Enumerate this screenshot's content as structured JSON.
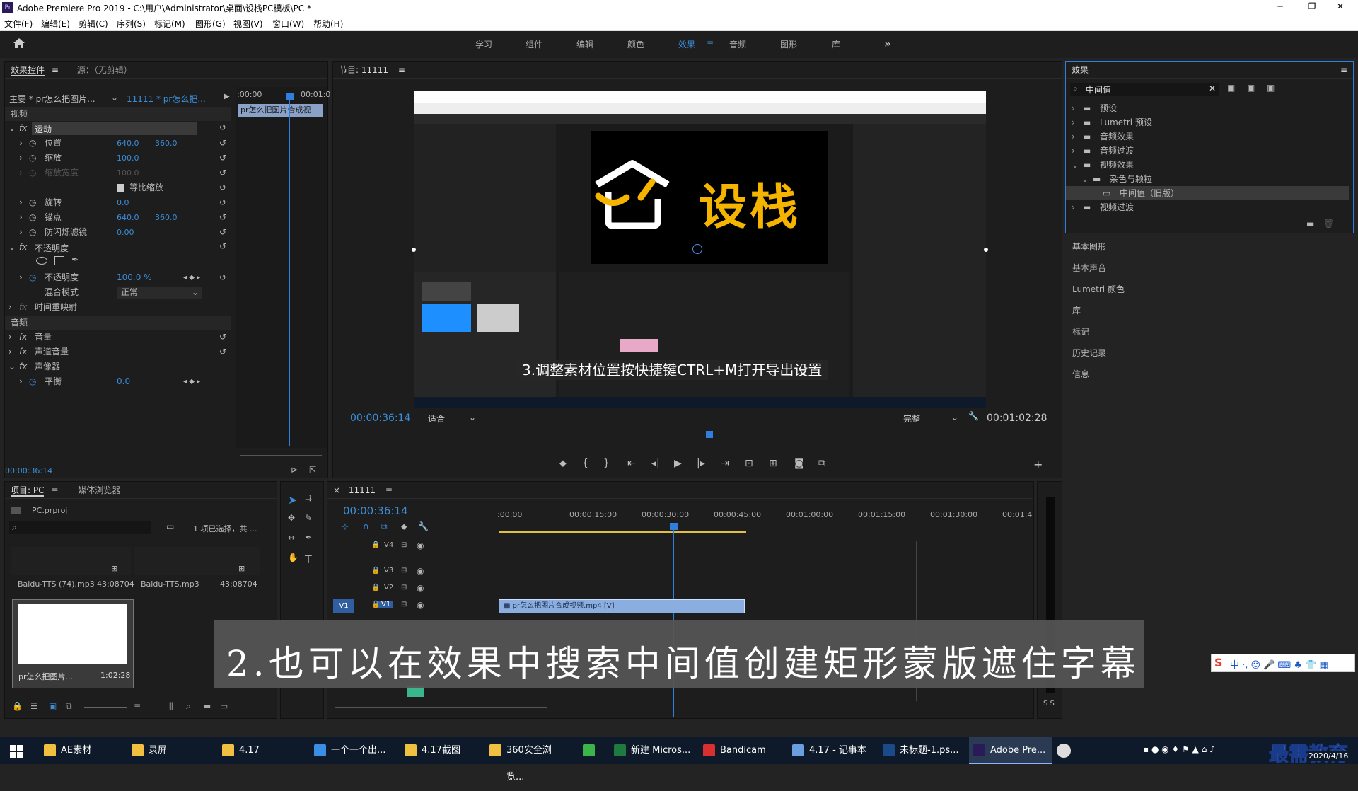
{
  "window": {
    "title": "Adobe Premiere Pro 2019 - C:\\用户\\Administrator\\桌面\\设栈PC模板\\PC *",
    "controls": [
      "─",
      "❐",
      "✕"
    ]
  },
  "menu": [
    "文件(F)",
    "编辑(E)",
    "剪辑(C)",
    "序列(S)",
    "标记(M)",
    "图形(G)",
    "视图(V)",
    "窗口(W)",
    "帮助(H)"
  ],
  "workspaces": [
    "学习",
    "组件",
    "编辑",
    "颜色",
    "效果",
    "音频",
    "图形",
    "库"
  ],
  "active_workspace": "效果",
  "workspace_more": "»",
  "effect_controls": {
    "tab": "效果控件",
    "source": "源：（无剪辑）",
    "master": "主要 * pr怎么把图片...",
    "seq": "11111 * pr怎么把...",
    "tl_start": ":00:00",
    "tl_end": "00:01:0",
    "clip_label": "pr怎么把图片合成视",
    "video_hdr": "视频",
    "audio_hdr": "音频",
    "motion": "运动",
    "rows": [
      {
        "label": "位置",
        "v1": "640.0",
        "v2": "360.0"
      },
      {
        "label": "缩放",
        "v1": "100.0",
        "v2": ""
      },
      {
        "label": "缩放宽度",
        "v1": "100.0",
        "v2": ""
      },
      {
        "label": "等比缩放",
        "v1": "",
        "v2": ""
      },
      {
        "label": "旋转",
        "v1": "0.0",
        "v2": ""
      },
      {
        "label": "锚点",
        "v1": "640.0",
        "v2": "360.0"
      },
      {
        "label": "防闪烁滤镜",
        "v1": "0.00",
        "v2": ""
      }
    ],
    "opacity": "不透明度",
    "opacity_label": "不透明度",
    "opacity_val": "100.0 %",
    "blend_label": "混合模式",
    "blend_val": "正常",
    "time_remap": "时间重映射",
    "volume": "音量",
    "channel_volume": "声道音量",
    "panner": "声像器",
    "balance": "平衡",
    "balance_val": "0.0",
    "timecode": "00:00:36:14"
  },
  "program": {
    "title": "节目: 11111",
    "timecode": "00:00:36:14",
    "fit": "适合",
    "quality": "完整",
    "duration": "00:01:02:28",
    "brand": "设栈",
    "caption": "3.调整素材位置按快捷键CTRL+M打开导出设置"
  },
  "effects": {
    "title": "效果",
    "search": "中间值",
    "tree": [
      {
        "label": "预设",
        "indent": 0,
        "open": false
      },
      {
        "label": "Lumetri 预设",
        "indent": 0,
        "open": false
      },
      {
        "label": "音频效果",
        "indent": 0,
        "open": false
      },
      {
        "label": "音频过渡",
        "indent": 0,
        "open": false
      },
      {
        "label": "视频效果",
        "indent": 0,
        "open": true
      },
      {
        "label": "杂色与颗粒",
        "indent": 1,
        "open": true
      },
      {
        "label": "中间值（旧版）",
        "indent": 2,
        "open": false
      },
      {
        "label": "视频过渡",
        "indent": 0,
        "open": false
      }
    ],
    "panels": [
      "基本图形",
      "基本声音",
      "Lumetri 颜色",
      "库",
      "标记",
      "历史记录",
      "信息"
    ]
  },
  "project": {
    "tab": "项目: PC",
    "tab2": "媒体浏览器",
    "file": "PC.prproj",
    "selection": "1 项已选择，共 ...",
    "items": [
      {
        "name": "Baidu-TTS (74).mp3",
        "dur": "43:08704"
      },
      {
        "name": "Baidu-TTS.mp3",
        "dur": "43:08704"
      },
      {
        "name": "pr怎么把图片...",
        "dur": "1:02:28"
      }
    ]
  },
  "timeline": {
    "tab": "11111",
    "timecode": "00:00:36:14",
    "ruler": [
      ":00:00",
      "00:00:15:00",
      "00:00:30:00",
      "00:00:45:00",
      "00:01:00:00",
      "00:01:15:00",
      "00:01:30:00",
      "00:01:4"
    ],
    "tracks": [
      "V4",
      "V3",
      "V2",
      "V1"
    ],
    "clip": "pr怎么把图片合成视频.mp4 [V]",
    "meter": "S S"
  },
  "subtitle": "2.也可以在效果中搜索中间值创建矩形蒙版遮住字幕",
  "taskbar": [
    {
      "label": "AE素材",
      "color": "#f0c040"
    },
    {
      "label": "录屏",
      "color": "#f0c040"
    },
    {
      "label": "4.17",
      "color": "#f0c040"
    },
    {
      "label": "一个一个出...",
      "color": "#3a8ee6"
    },
    {
      "label": "4.17截图",
      "color": "#f0c040"
    },
    {
      "label": "360安全浏览...",
      "color": "#f0c040"
    },
    {
      "label": "",
      "color": "#3bb54a"
    },
    {
      "label": "新建 Micros...",
      "color": "#1f7a3f"
    },
    {
      "label": "Bandicam",
      "color": "#d83030"
    },
    {
      "label": "4.17 - 记事本",
      "color": "#6aa0e0"
    },
    {
      "label": "未标题-1.ps...",
      "color": "#1a4a8a"
    },
    {
      "label": "Adobe Pre...",
      "color": "#2a1a5a"
    }
  ],
  "watermark": {
    "text": "最需教育",
    "date": "2020/4/16"
  },
  "colors": {
    "accent": "#3b8dd8",
    "playhead": "#2f7fe0",
    "clip": "#8aaee0",
    "subtitle_bg": "#555555"
  }
}
